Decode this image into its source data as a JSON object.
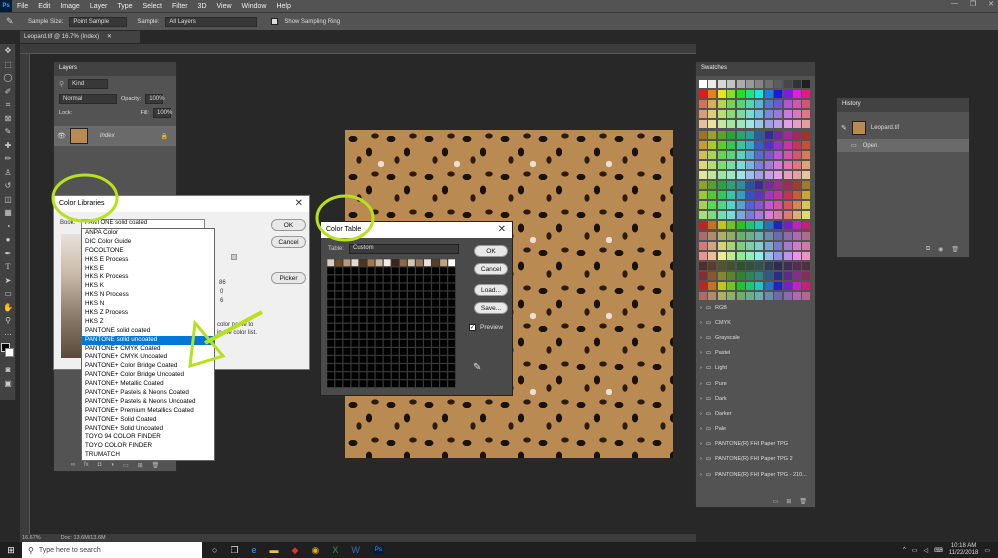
{
  "menubar": {
    "logo": "Ps",
    "items": [
      "File",
      "Edit",
      "Image",
      "Layer",
      "Type",
      "Select",
      "Filter",
      "3D",
      "View",
      "Window",
      "Help"
    ]
  },
  "options": {
    "sample_size_label": "Sample Size:",
    "sample_size_value": "Point Sample",
    "sample_label": "Sample:",
    "sample_value": "All Layers",
    "ring_label": "Show Sampling Ring"
  },
  "document": {
    "tab_title": "Leopard.tif @ 16.7% (Index)",
    "zoom": "16.67%",
    "doc_info": "Doc: 13.6M/13.6M"
  },
  "layers": {
    "tab": "Layers",
    "kind_placeholder": "Kind",
    "blend_mode": "Normal",
    "opacity_label": "Opacity:",
    "opacity_value": "100%",
    "lock_label": "Lock:",
    "fill_label": "Fill:",
    "fill_value": "100%",
    "layer_name": "Index"
  },
  "color_libraries": {
    "title": "Color Libraries",
    "book_label": "Book:",
    "book_value": "PANTONE solid coated",
    "ok": "OK",
    "cancel": "Cancel",
    "picker": "Picker",
    "hint_line1": "color name to",
    "hint_line2": "in the color list.",
    "values": [
      "86",
      "0",
      "6"
    ],
    "books": [
      "ANPA Color",
      "DIC Color Guide",
      "FOCOLTONE",
      "HKS E Process",
      "HKS E",
      "HKS K Process",
      "HKS K",
      "HKS N Process",
      "HKS N",
      "HKS Z Process",
      "HKS Z",
      "PANTONE solid coated",
      "PANTONE solid uncoated",
      "PANTONE+ CMYK Coated",
      "PANTONE+ CMYK Uncoated",
      "PANTONE+ Color Bridge Coated",
      "PANTONE+ Color Bridge Uncoated",
      "PANTONE+ Metallic Coated",
      "PANTONE+ Pastels & Neons Coated",
      "PANTONE+ Pastels & Neons Uncoated",
      "PANTONE+ Premium Metallics Coated",
      "PANTONE+ Solid Coated",
      "PANTONE+ Solid Uncoated",
      "TOYO 94 COLOR FINDER",
      "TOYO COLOR FINDER",
      "TRUMATCH"
    ],
    "selected_index": 12
  },
  "color_table": {
    "title": "Color Table",
    "table_label": "Table:",
    "table_value": "Custom",
    "ok": "OK",
    "cancel": "Cancel",
    "load": "Load...",
    "save": "Save...",
    "preview": "Preview",
    "first_row_colors": [
      "#d8d0c4",
      "#6b4a2e",
      "#b89a7a",
      "#e6ddd0",
      "#4a3422",
      "#a07850",
      "#c8b8a4",
      "#f2ebe2",
      "#382619",
      "#8a6a4a",
      "#d4c4b0",
      "#9a7a5a",
      "#eae2d6",
      "#5a3e28",
      "#c4a07c",
      "#ffffff",
      "#000000"
    ]
  },
  "swatches": {
    "tab": "Swatches",
    "folders": [
      "RGB",
      "CMYK",
      "Grayscale",
      "Pastel",
      "Light",
      "Pure",
      "Dark",
      "Darker",
      "Pale",
      "PANTONE(R) FHI Paper TPG",
      "PANTONE(R) FHI Paper TPG 2",
      "PANTONE(R) FHI Paper TPG - 210..."
    ]
  },
  "history": {
    "tab": "History",
    "snapshot": "Leopard.tif",
    "state": "Open"
  },
  "taskbar": {
    "search_placeholder": "Type here to search",
    "time": "10:18 AM",
    "date": "11/22/2018"
  },
  "colors": {
    "annotation": "#b7e01e",
    "selection": "#0078d7"
  }
}
